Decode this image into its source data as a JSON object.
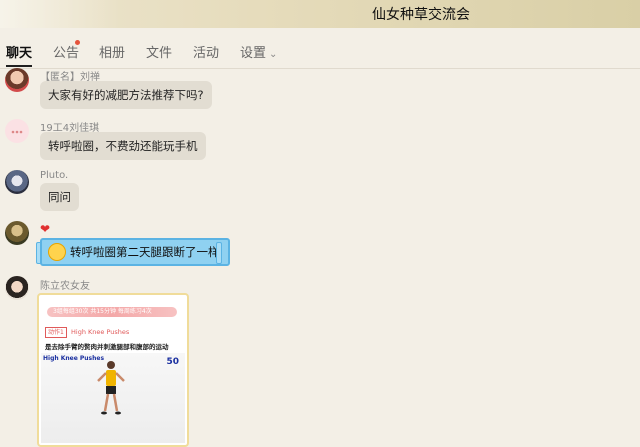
{
  "window": {
    "title": "仙女种草交流会"
  },
  "tabs": [
    {
      "label": "聊天"
    },
    {
      "label": "公告"
    },
    {
      "label": "相册"
    },
    {
      "label": "文件"
    },
    {
      "label": "活动"
    },
    {
      "label": "设置"
    }
  ],
  "messages": [
    {
      "sender": "【匿名】刘禅",
      "text": "大家有好的减肥方法推荐下吗?"
    },
    {
      "sender": "19工4刘佳琪",
      "text": "转呼啦圈，不费劲还能玩手机"
    },
    {
      "sender": "Pluto.",
      "text": "同问"
    },
    {
      "sender": "",
      "text": "转呼啦圈第二天腿跟断了一样"
    },
    {
      "sender": "陈立农女友"
    }
  ],
  "card": {
    "banner_text": "3组每组30次 共15分钟 每周练习4次",
    "exercise_num": "动作1",
    "exercise_name": "High Knee Pushes",
    "description": "是去除手臂的赘肉并刺激腿部和腹部的运动",
    "photo_label": "High Knee Pushes",
    "count": "50"
  },
  "colors": {
    "accent": "#1f1f1f",
    "bubble": "#e2ddd2",
    "special_bubble": "#8fd1f1",
    "notice_dot": "#e5533b"
  }
}
